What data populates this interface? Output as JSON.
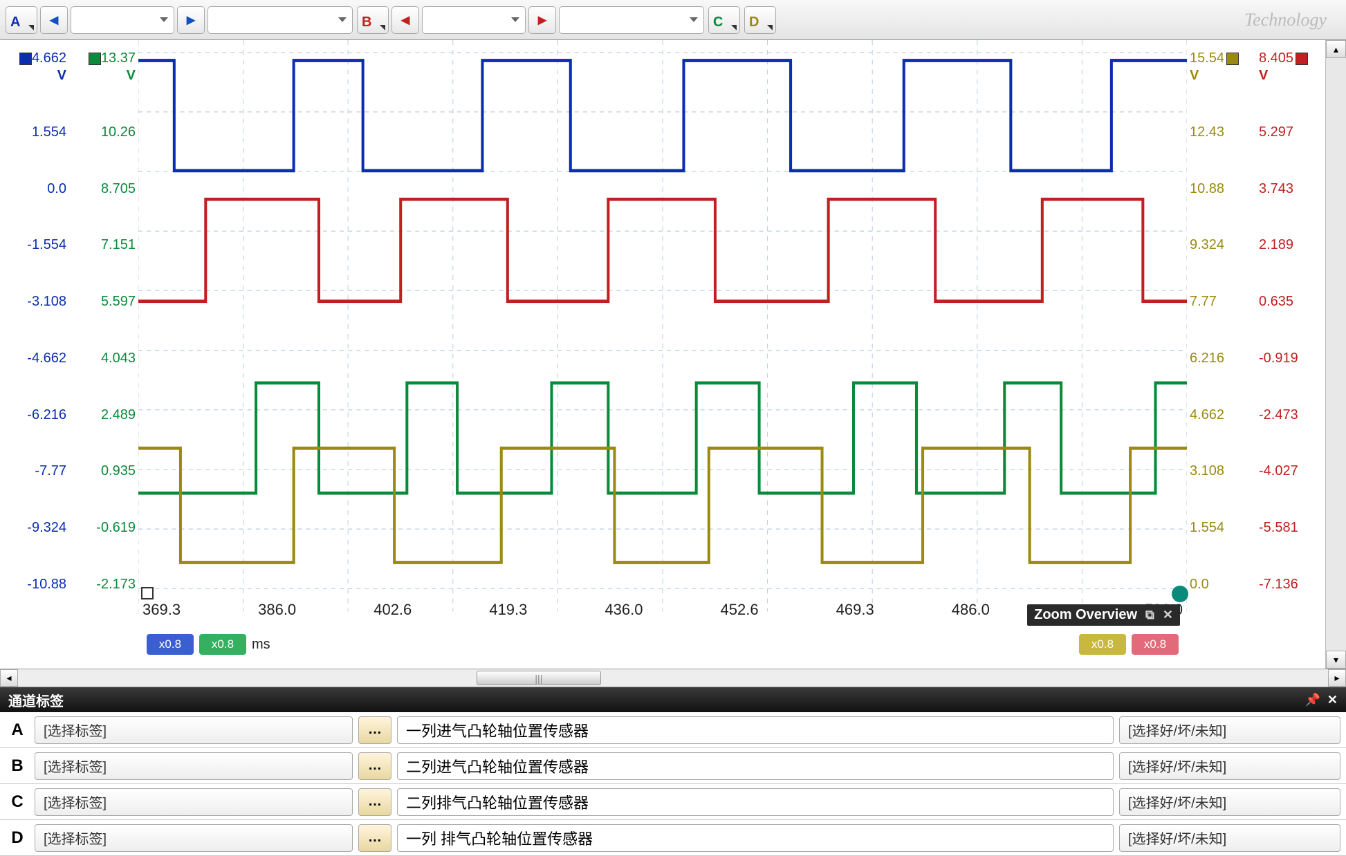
{
  "toolbar": {
    "channels": [
      "A",
      "B",
      "C",
      "D"
    ],
    "logo": "Technology"
  },
  "yaxis": {
    "blue": {
      "unit": "V",
      "ticks": [
        "4.662",
        "1.554",
        "0.0",
        "-1.554",
        "-3.108",
        "-4.662",
        "-6.216",
        "-7.77",
        "-9.324",
        "-10.88"
      ]
    },
    "green": {
      "unit": "V",
      "ticks": [
        "13.37",
        "10.26",
        "8.705",
        "7.151",
        "5.597",
        "4.043",
        "2.489",
        "0.935",
        "-0.619",
        "-2.173"
      ]
    },
    "olive": {
      "unit": "V",
      "ticks": [
        "15.54",
        "12.43",
        "10.88",
        "9.324",
        "7.77",
        "6.216",
        "4.662",
        "3.108",
        "1.554",
        "0.0"
      ]
    },
    "red": {
      "unit": "V",
      "ticks": [
        "8.405",
        "5.297",
        "3.743",
        "2.189",
        "0.635",
        "-0.919",
        "-2.473",
        "-4.027",
        "-5.581",
        "-7.136"
      ]
    }
  },
  "xaxis": {
    "ticks": [
      "369.3",
      "386.0",
      "402.6",
      "419.3",
      "436.0",
      "452.6",
      "469.3",
      "486.0",
      "",
      "536.0"
    ],
    "unit": "ms"
  },
  "zoom_overview": "Zoom Overview",
  "zoom_level": "x0.8",
  "panel_title": "通道标签",
  "labels_rows": [
    {
      "ch": "A",
      "sel": "[选择标签]",
      "desc": "一列进气凸轮轴位置传感器",
      "cond": "[选择好/坏/未知]"
    },
    {
      "ch": "B",
      "sel": "[选择标签]",
      "desc": "二列进气凸轮轴位置传感器",
      "cond": "[选择好/坏/未知]"
    },
    {
      "ch": "C",
      "sel": "[选择标签]",
      "desc": "二列排气凸轮轴位置传感器",
      "cond": "[选择好/坏/未知]"
    },
    {
      "ch": "D",
      "sel": "[选择标签]",
      "desc": "一列 排气凸轮轴位置传感器",
      "cond": "[选择好/坏/未知]"
    }
  ],
  "chart_data": {
    "type": "line",
    "xlabel": "ms",
    "xlim": [
      369.3,
      536.0
    ],
    "series": [
      {
        "name": "A",
        "color": "#0b2db0",
        "unit": "V",
        "ylim": [
          -10.88,
          4.662
        ],
        "low": 0.2,
        "high": 4.6,
        "edges": [
          369,
          375,
          394,
          405,
          424,
          438,
          456,
          473,
          491,
          508,
          524,
          536
        ],
        "levels": [
          "H",
          "L",
          "H",
          "L",
          "H",
          "L",
          "H",
          "L",
          "H",
          "L",
          "H"
        ]
      },
      {
        "name": "B",
        "color": "#c02020",
        "unit": "V",
        "ylim": [
          -7.136,
          8.405
        ],
        "low": 0.6,
        "high": 5.0,
        "edges": [
          369,
          380,
          398,
          411,
          428,
          444,
          461,
          479,
          496,
          513,
          529,
          536
        ],
        "levels": [
          "L",
          "H",
          "L",
          "H",
          "L",
          "H",
          "L",
          "H",
          "L",
          "H",
          "L"
        ]
      },
      {
        "name": "C",
        "color": "#0a8a3a",
        "unit": "V",
        "ylim": [
          -2.173,
          13.37
        ],
        "low": 0.9,
        "high": 4.0,
        "edges": [
          369,
          388,
          398,
          412,
          420,
          435,
          444,
          458,
          468,
          483,
          493,
          507,
          516,
          531,
          536
        ],
        "levels": [
          "L",
          "H",
          "L",
          "H",
          "L",
          "H",
          "L",
          "H",
          "L",
          "H",
          "L",
          "H",
          "L",
          "H"
        ]
      },
      {
        "name": "D",
        "color": "#9a8a10",
        "unit": "V",
        "ylim": [
          0.0,
          15.54
        ],
        "low": 0.05,
        "high": 3.2,
        "edges": [
          369,
          376,
          394,
          410,
          427,
          445,
          460,
          478,
          494,
          511,
          527,
          536
        ],
        "levels": [
          "H",
          "L",
          "H",
          "L",
          "H",
          "L",
          "H",
          "L",
          "H",
          "L",
          "H"
        ]
      }
    ]
  }
}
